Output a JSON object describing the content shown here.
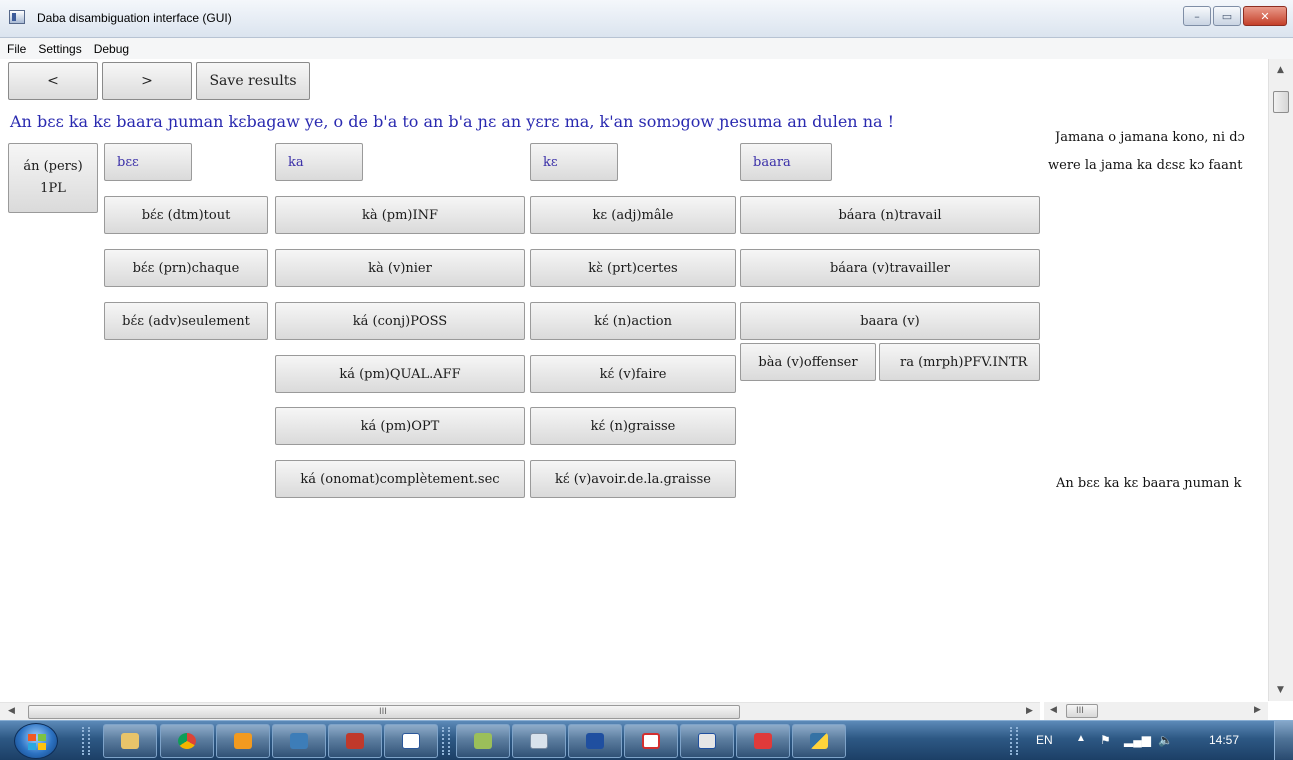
{
  "window": {
    "title": "Daba disambiguation interface (GUI)",
    "controls": {
      "minimize": "–",
      "maximize": "▭",
      "close": "✕"
    }
  },
  "menu": [
    "File",
    "Settings",
    "Debug"
  ],
  "toolbar": {
    "prev_label": "<",
    "next_label": ">",
    "save_label": "Save results"
  },
  "sentence": "An bɛɛ ka kɛ baara ɲuman kɛbagaw ye, o de b'a to an b'a ɲɛ an yɛrɛ ma, k'an somɔgow ɲesuma an dulen na !",
  "columns": [
    {
      "token": "án (pers)",
      "token_sub": "1PL",
      "options": []
    },
    {
      "token": "bɛɛ",
      "options": [
        "bɛ́ɛ (dtm)tout",
        "bɛ́ɛ (prn)chaque",
        "bɛ́ɛ (adv)seulement"
      ]
    },
    {
      "token": "ka",
      "options": [
        "kà (pm)INF",
        "kà (v)nier",
        "ká (conj)POSS",
        "ká (pm)QUAL.AFF",
        "ká (pm)OPT",
        "ká (onomat)complètement.sec"
      ]
    },
    {
      "token": "kɛ",
      "options": [
        "kɛ (adj)mâle",
        "kɛ̀ (prt)certes",
        "kɛ́ (n)action",
        "kɛ́ (v)faire",
        "kɛ́ (n)graisse",
        "kɛ́ (v)avoir.de.la.graisse"
      ]
    },
    {
      "token": "baara",
      "options": [
        "báara (n)travail",
        "báara (v)travailler",
        "baara (v)"
      ],
      "sub_options": [
        "bàa (v)offenser",
        "ra (mrph)PFV.INTR"
      ]
    }
  ],
  "right_pane": {
    "line1": "Jamana o jamana kono, ni dɔ",
    "line2": "were la jama ka dɛsɛ kɔ faant",
    "line3": "An bɛɛ ka kɛ baara ɲuman k"
  },
  "scrollbar": {
    "h_grip": "III"
  },
  "taskbar": {
    "language": "EN",
    "time": "14:57",
    "apps": [
      "file-explorer",
      "chrome",
      "media-player",
      "app-4",
      "app-5",
      "word",
      "app-7",
      "app-8",
      "app-9",
      "pdf-reader",
      "app-11",
      "app-12",
      "python"
    ]
  },
  "colors": {
    "token_text": "#3a2fa8",
    "sentence_text": "#2a2ab0",
    "taskbar": "#2d5884"
  }
}
